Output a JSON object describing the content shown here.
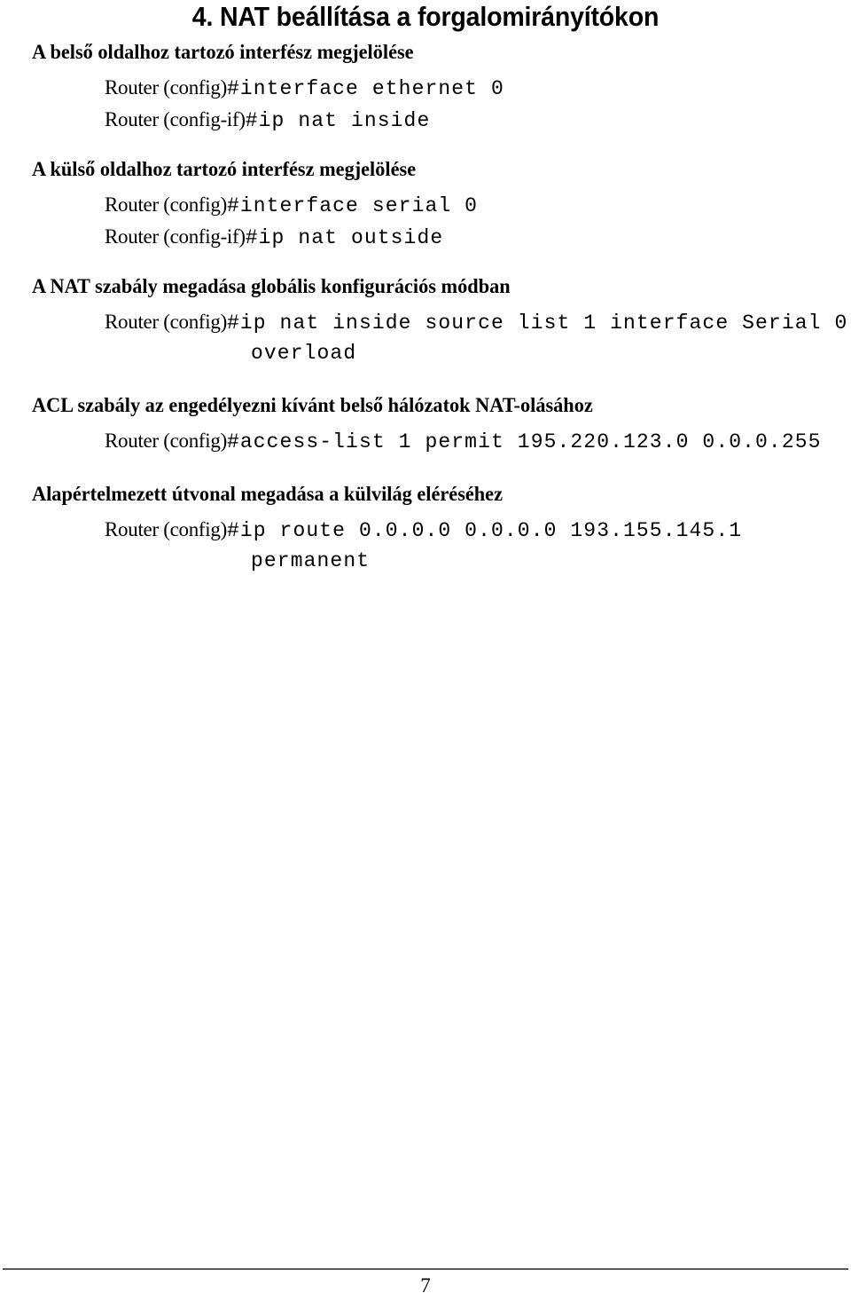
{
  "document": {
    "title": "4. NAT beállítása a forgalomirányítókon",
    "page_number": "7"
  },
  "sections": [
    {
      "heading": "A belső oldalhoz tartozó interfész megjelölése",
      "commands": [
        {
          "prompt": "Router (config)",
          "text": "#interface ethernet 0",
          "continuation": ""
        },
        {
          "prompt": "Router (config-if)",
          "text": "#ip nat inside",
          "continuation": ""
        }
      ]
    },
    {
      "heading": "A külső oldalhoz tartozó interfész megjelölése",
      "commands": [
        {
          "prompt": "Router (config)",
          "text": "#interface serial 0",
          "continuation": ""
        },
        {
          "prompt": "Router (config-if)",
          "text": "#ip nat outside",
          "continuation": ""
        }
      ]
    },
    {
      "heading": "A NAT szabály megadása globális konfigurációs módban",
      "commands": [
        {
          "prompt": "Router (config)",
          "text": "#ip nat inside source list 1 interface Serial 0",
          "continuation": "overload"
        }
      ]
    },
    {
      "heading": "ACL szabály az engedélyezni kívánt belső hálózatok NAT-olásához",
      "commands": [
        {
          "prompt": "Router (config)",
          "text": "#access-list 1 permit 195.220.123.0 0.0.0.255",
          "continuation": ""
        }
      ]
    },
    {
      "heading": "Alapértelmezett útvonal megadása a külvilág eléréséhez",
      "commands": [
        {
          "prompt": "Router (config)",
          "text": "#ip route 0.0.0.0 0.0.0.0 193.155.145.1",
          "continuation": "permanent"
        }
      ]
    }
  ]
}
